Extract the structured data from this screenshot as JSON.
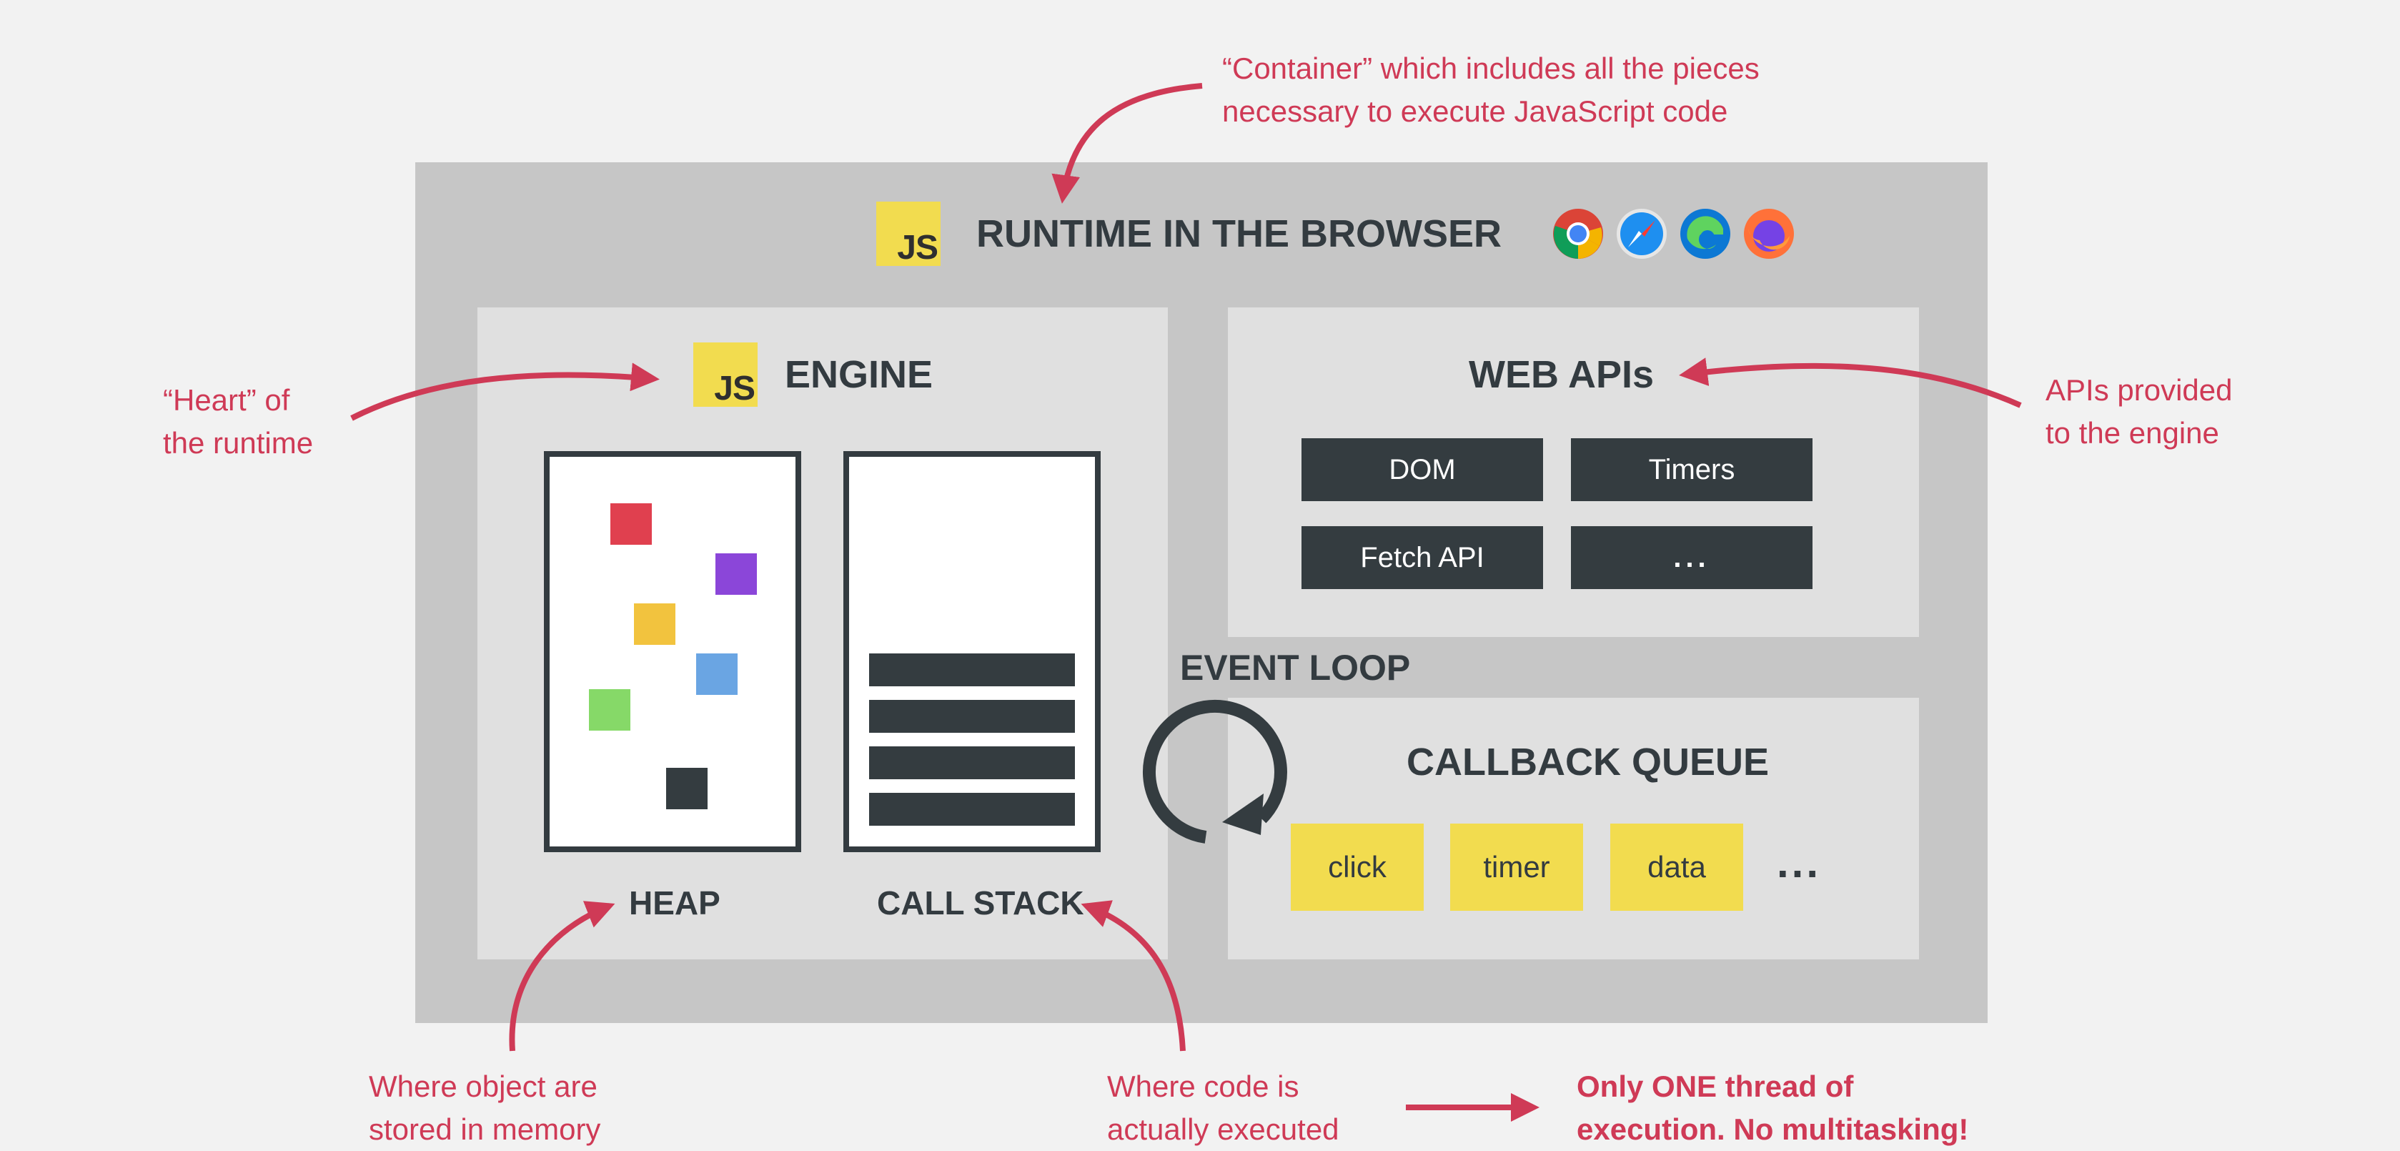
{
  "annotations": {
    "container": [
      "“Container” which includes all the pieces",
      "necessary to execute JavaScript code"
    ],
    "heart": [
      "“Heart” of",
      "the runtime"
    ],
    "apis": [
      "APIs provided",
      "to the engine"
    ],
    "heap": [
      "Where object are",
      "stored in memory"
    ],
    "stack": [
      "Where code is",
      "actually executed"
    ],
    "thread": [
      "Only ONE thread of",
      "execution. No multitasking!"
    ]
  },
  "runtime": {
    "badge": "JS",
    "title": "RUNTIME IN THE BROWSER",
    "browsers": [
      "chrome-icon",
      "safari-icon",
      "edge-icon",
      "firefox-icon"
    ]
  },
  "engine": {
    "badge": "JS",
    "title": "ENGINE",
    "heap_label": "HEAP",
    "stack_label": "CALL STACK",
    "heap_colors": [
      "#e0404f",
      "#8b46d9",
      "#f2c33e",
      "#6aa5e3",
      "#86d968",
      "#343c40"
    ]
  },
  "web_apis": {
    "title": "WEB APIs",
    "items": [
      "DOM",
      "Timers",
      "Fetch API",
      "..."
    ]
  },
  "event_loop": {
    "label": "EVENT LOOP"
  },
  "callback_queue": {
    "title": "CALLBACK QUEUE",
    "items": [
      "click",
      "timer",
      "data"
    ],
    "more": "..."
  },
  "colors": {
    "accent": "#cf3a56",
    "dark": "#333b40",
    "js_yellow": "#f2dc4f",
    "background": "#f2f2f2",
    "outer_panel": "#c6c6c6",
    "inner_panel": "#e0e0e0"
  }
}
